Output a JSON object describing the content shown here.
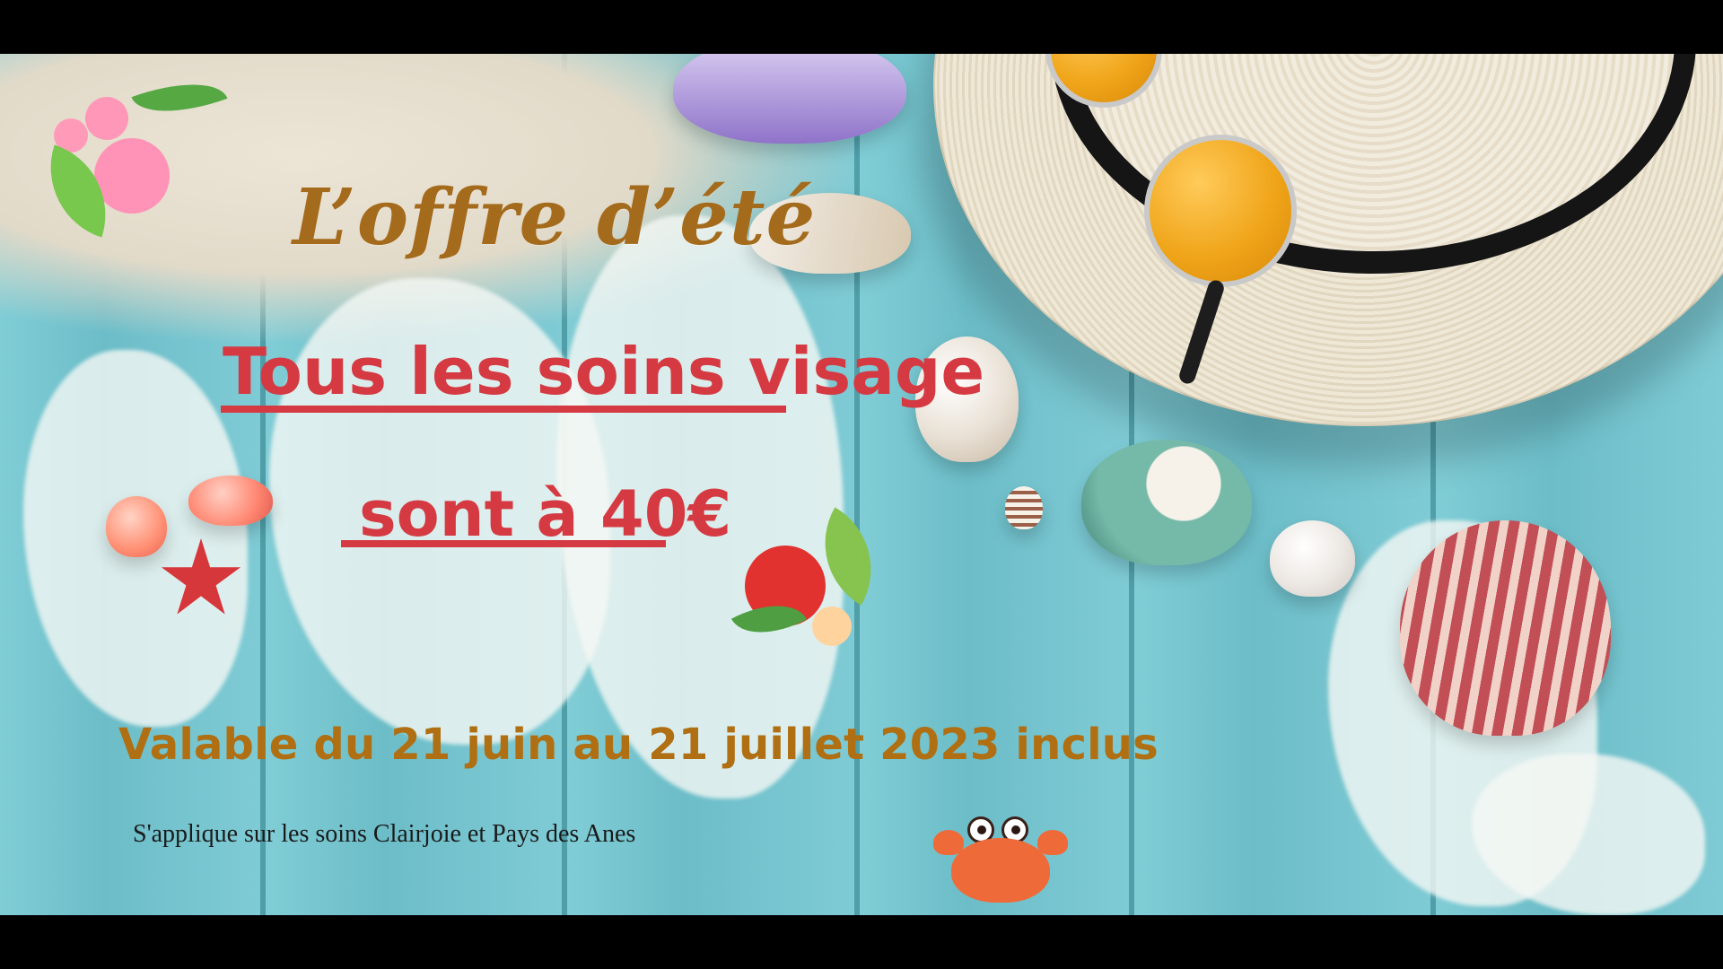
{
  "scene": {
    "title_line": "L’offre d’été",
    "offer_line_1": "Tous les soins visage",
    "offer_line_2": "sont à 40€",
    "validity": "Valable du 21 juin au 21 juillet 2023 inclus",
    "applies_to": "S'applique sur les soins Clairjoie et Pays des Anes"
  },
  "icons": {
    "flower_cluster": "hibiscus-cluster-icon",
    "shell_group": "seashell-group-icon",
    "starfish": "starfish-icon",
    "crab": "crab-icon"
  },
  "colors": {
    "headline": "#a56b1c",
    "offer": "#d53a42",
    "validity": "#b06f12",
    "applies": "#1a1a1a",
    "wood": "#6bbfca"
  }
}
